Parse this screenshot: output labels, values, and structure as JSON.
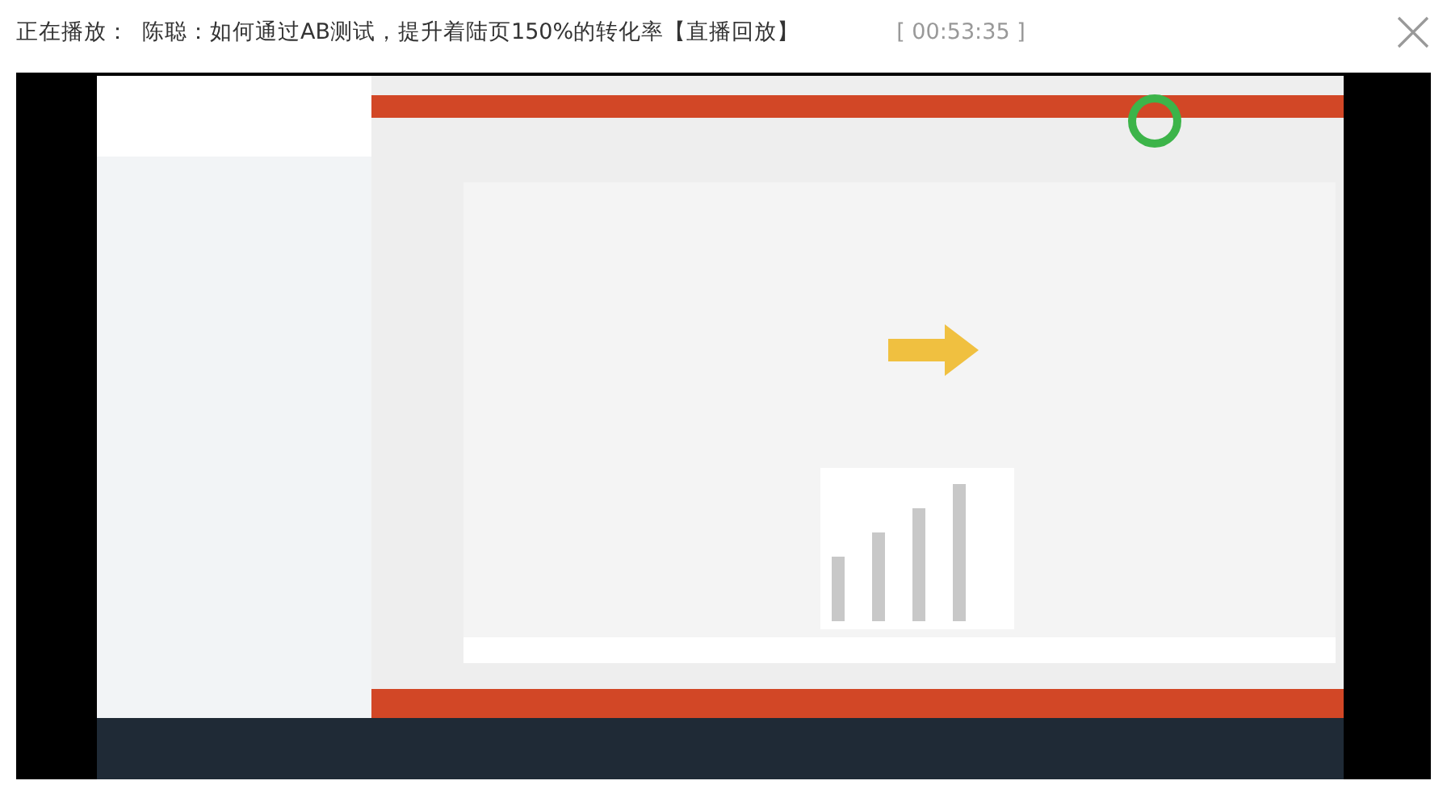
{
  "header": {
    "label": "正在播放：",
    "title": "陈聪：如何通过AB测试，提升着陆页150%的转化率【直播回放】",
    "time": "[ 00:53:35 ]"
  }
}
